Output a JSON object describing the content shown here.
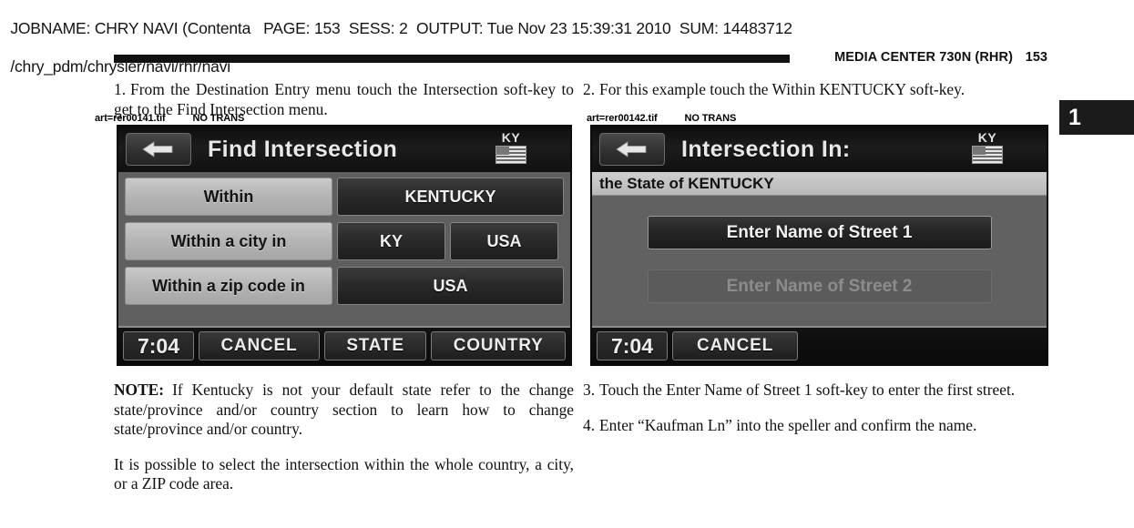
{
  "print_header": {
    "line1_parts": [
      "JOBNAME: CHRY NAVI (Contenta",
      "PAGE: 153",
      "SESS: 2",
      "OUTPUT: Tue Nov 23 15:39:31 2010",
      "SUM: 14483712"
    ],
    "line1": "JOBNAME: CHRY NAVI (Contenta   PAGE: 153  SESS: 2  OUTPUT: Tue Nov 23 15:39:31 2010  SUM: 14483712",
    "line2": "/chry_pdm/chrysler/navi/rhr/navi"
  },
  "running_head": {
    "title": "MEDIA CENTER 730N (RHR)",
    "page_number": "153"
  },
  "chapter_tab": {
    "number": "1"
  },
  "art_notes": {
    "left": {
      "file": "art=rer00141.tif",
      "trans": "NO TRANS"
    },
    "right": {
      "file": "art=rer00142.tif",
      "trans": "NO TRANS"
    }
  },
  "left_column": {
    "step1": {
      "number": "1.",
      "text": "From the Destination Entry menu touch the Intersection soft-key to get to the Find Intersection menu."
    },
    "note": {
      "label": "NOTE:",
      "text": "If Kentucky is not your default state refer to the change state/province and/or country section to learn how to change state/province and/or country."
    },
    "paragraph": "It is possible to select the intersection within the whole country, a city, or a ZIP code area."
  },
  "right_column": {
    "step2": {
      "number": "2.",
      "text": "For this example touch the Within KENTUCKY soft-key."
    },
    "step3": {
      "number": "3.",
      "text": "Touch the Enter Name of Street 1 soft-key to enter the first street."
    },
    "step4": {
      "number": "4.",
      "text": "Enter “Kaufman Ln” into the speller and confirm the name."
    }
  },
  "nav_screen_1": {
    "title": "Find Intersection",
    "state_abbr": "KY",
    "rows": [
      {
        "label": "Within",
        "values": [
          "KENTUCKY"
        ]
      },
      {
        "label": "Within a city in",
        "values": [
          "KY",
          "USA"
        ]
      },
      {
        "label": "Within a zip code in",
        "values": [
          "USA"
        ]
      }
    ],
    "bottom_bar": {
      "clock": "7:04",
      "keys": [
        "CANCEL",
        "STATE",
        "COUNTRY"
      ]
    }
  },
  "nav_screen_2": {
    "title": "Intersection In:",
    "state_abbr": "KY",
    "subheader": "the State of KENTUCKY",
    "street_keys": [
      {
        "label": "Enter Name of Street 1",
        "enabled": true
      },
      {
        "label": "Enter Name of Street 2",
        "enabled": false
      }
    ],
    "bottom_bar": {
      "clock": "7:04",
      "keys": [
        "CANCEL"
      ]
    }
  }
}
